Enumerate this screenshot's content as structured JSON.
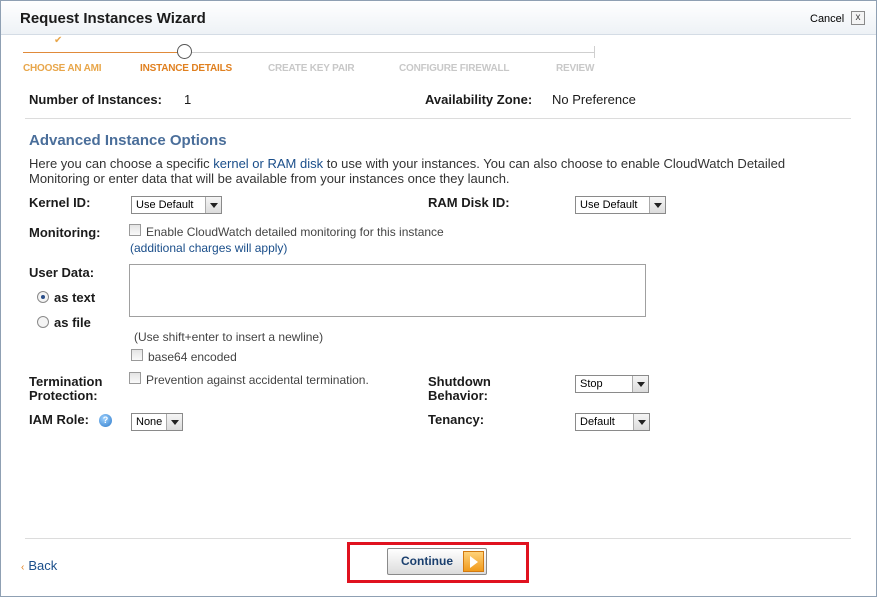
{
  "window": {
    "title": "Request Instances Wizard",
    "cancel_label": "Cancel",
    "close_glyph": "x"
  },
  "steps": [
    {
      "label": "CHOOSE AN AMI",
      "state": "done"
    },
    {
      "label": "INSTANCE DETAILS",
      "state": "current"
    },
    {
      "label": "CREATE KEY PAIR",
      "state": "future"
    },
    {
      "label": "CONFIGURE FIREWALL",
      "state": "future"
    },
    {
      "label": "REVIEW",
      "state": "future"
    }
  ],
  "summary": {
    "instances_label": "Number of Instances:",
    "instances_value": "1",
    "zone_label": "Availability Zone:",
    "zone_value": "No Preference"
  },
  "advanced": {
    "title": "Advanced Instance Options",
    "desc_before": "Here you can choose a specific ",
    "desc_link": "kernel or RAM disk",
    "desc_after": " to use with your instances. You can also choose to enable CloudWatch Detailed Monitoring or enter data that will be available from your instances once they launch."
  },
  "form": {
    "kernel_label": "Kernel ID:",
    "kernel_value": "Use Default",
    "ramdisk_label": "RAM Disk ID:",
    "ramdisk_value": "Use Default",
    "monitoring_label": "Monitoring:",
    "monitoring_checkbox": "Enable CloudWatch detailed monitoring for this instance",
    "monitoring_note": "(additional charges will apply)",
    "userdata_label": "User Data:",
    "as_text": "as text",
    "as_file": "as file",
    "userdata_hint": "(Use shift+enter to insert a newline)",
    "base64_label": "base64 encoded",
    "termination_label_1": "Termination",
    "termination_label_2": "Protection:",
    "termination_checkbox": "Prevention against accidental termination.",
    "shutdown_label_1": "Shutdown",
    "shutdown_label_2": "Behavior:",
    "shutdown_value": "Stop",
    "iam_label": "IAM Role:",
    "iam_value": "None",
    "tenancy_label": "Tenancy:",
    "tenancy_value": "Default"
  },
  "footer": {
    "back_label": "Back",
    "continue_label": "Continue"
  },
  "colors": {
    "accent_orange": "#e08020",
    "section_blue": "#4a6e9a",
    "link_blue": "#1a4e8a",
    "highlight_red": "#e0121f"
  }
}
